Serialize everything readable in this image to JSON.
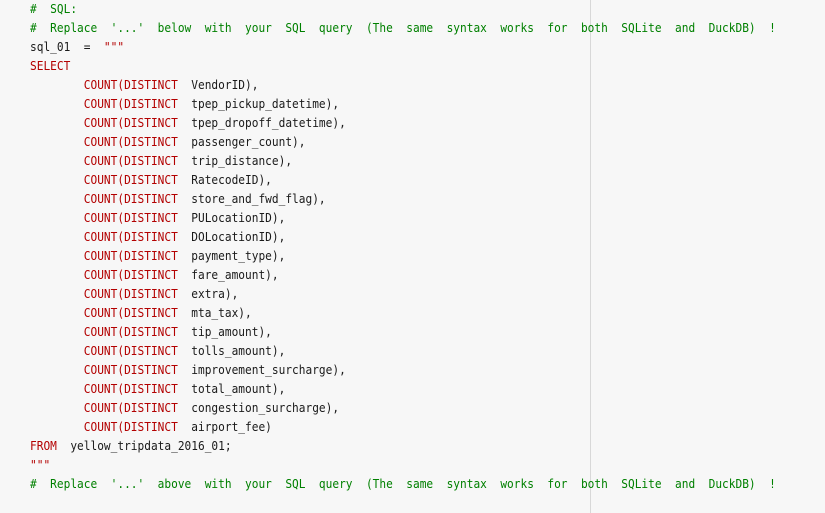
{
  "editor": {
    "comment_top_1": "#  SQL:",
    "comment_top_2": "#  Replace  '...'  below  with  your  SQL  query  (The  same  syntax  works  for  both  SQLite  and  DuckDB)  !",
    "assign_var": "sql_01",
    "assign_op": "=",
    "triple_quote_open": "\"\"\"",
    "select_kw": "SELECT",
    "count_fn": "COUNT(DISTINCT",
    "columns": [
      "VendorID),",
      "tpep_pickup_datetime),",
      "tpep_dropoff_datetime),",
      "passenger_count),",
      "trip_distance),",
      "RatecodeID),",
      "store_and_fwd_flag),",
      "PULocationID),",
      "DOLocationID),",
      "payment_type),",
      "fare_amount),",
      "extra),",
      "mta_tax),",
      "tip_amount),",
      "tolls_amount),",
      "improvement_surcharge),",
      "total_amount),",
      "congestion_surcharge),",
      "airport_fee)"
    ],
    "from_kw": "FROM",
    "table_name": "yellow_tripdata_2016_01;",
    "triple_quote_close": "\"\"\"",
    "comment_bottom": "#  Replace  '...'  above  with  your  SQL  query  (The  same  syntax  works  for  both  SQLite  and  DuckDB)  !"
  }
}
